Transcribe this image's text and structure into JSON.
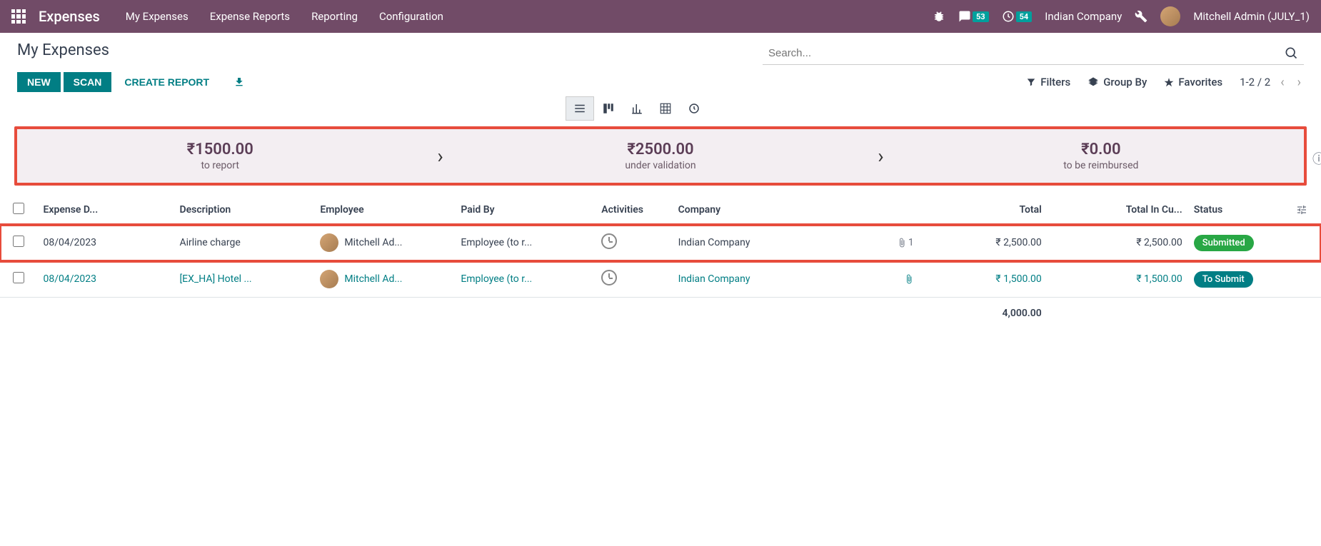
{
  "nav": {
    "app_title": "Expenses",
    "menu": [
      "My Expenses",
      "Expense Reports",
      "Reporting",
      "Configuration"
    ],
    "messages_count": "53",
    "activities_count": "54",
    "company": "Indian Company",
    "user": "Mitchell Admin (JULY_1)"
  },
  "control": {
    "breadcrumb": "My Expenses",
    "new_btn": "NEW",
    "scan_btn": "SCAN",
    "create_report": "CREATE REPORT",
    "search_placeholder": "Search...",
    "filters": "Filters",
    "groupby": "Group By",
    "favorites": "Favorites",
    "pager": "1-2 / 2"
  },
  "dashboard": {
    "to_report_amount": "₹1500.00",
    "to_report_label": "to report",
    "under_validation_amount": "₹2500.00",
    "under_validation_label": "under validation",
    "to_reimburse_amount": "₹0.00",
    "to_reimburse_label": "to be reimbursed"
  },
  "table": {
    "headers": {
      "date": "Expense D...",
      "description": "Description",
      "employee": "Employee",
      "paid_by": "Paid By",
      "activities": "Activities",
      "company": "Company",
      "total": "Total",
      "total_currency": "Total In Cu...",
      "status": "Status"
    },
    "rows": [
      {
        "date": "08/04/2023",
        "description": "Airline charge",
        "employee": "Mitchell Ad...",
        "paid_by": "Employee (to r...",
        "company": "Indian Company",
        "attachment_count": "1",
        "total": "₹ 2,500.00",
        "total_currency": "₹ 2,500.00",
        "status": "Submitted",
        "status_class": "badge-submitted",
        "highlight": true,
        "link": false
      },
      {
        "date": "08/04/2023",
        "description": "[EX_HA] Hotel ...",
        "employee": "Mitchell Ad...",
        "paid_by": "Employee (to r...",
        "company": "Indian Company",
        "attachment_count": "",
        "total": "₹ 1,500.00",
        "total_currency": "₹ 1,500.00",
        "status": "To Submit",
        "status_class": "badge-tosubmit",
        "highlight": false,
        "link": true
      }
    ],
    "footer_total": "4,000.00"
  }
}
